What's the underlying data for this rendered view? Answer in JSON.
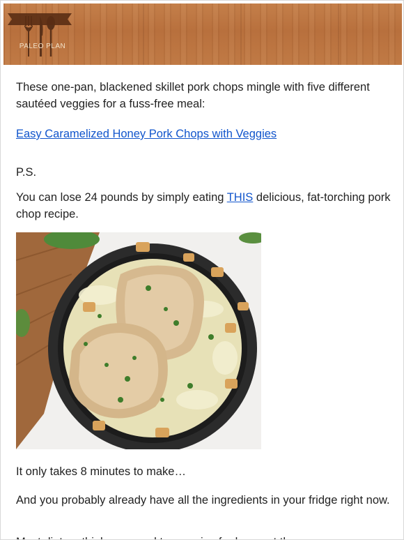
{
  "header": {
    "logo_text": "PALEO PLAN"
  },
  "body": {
    "intro": "These one-pan, blackened skillet pork chops mingle with five different sautéed veggies for a fuss-free meal:",
    "recipe_link": "Easy Caramelized Honey Pork Chops with Veggies",
    "ps": "P.S.",
    "lose_text_before": "You can lose 24 pounds by simply eating ",
    "this_link": "THIS",
    "lose_text_after": " delicious, fat-torching pork chop recipe.",
    "minutes": "It only takes 8 minutes to make…",
    "ingredients": "And you probably already have all the ingredients in your fridge right now.",
    "dieters": "Most dieters think you need to exercise for hours at the gym..."
  },
  "colors": {
    "link": "#1155cc",
    "text": "#222222",
    "wood": "#c07a45"
  }
}
